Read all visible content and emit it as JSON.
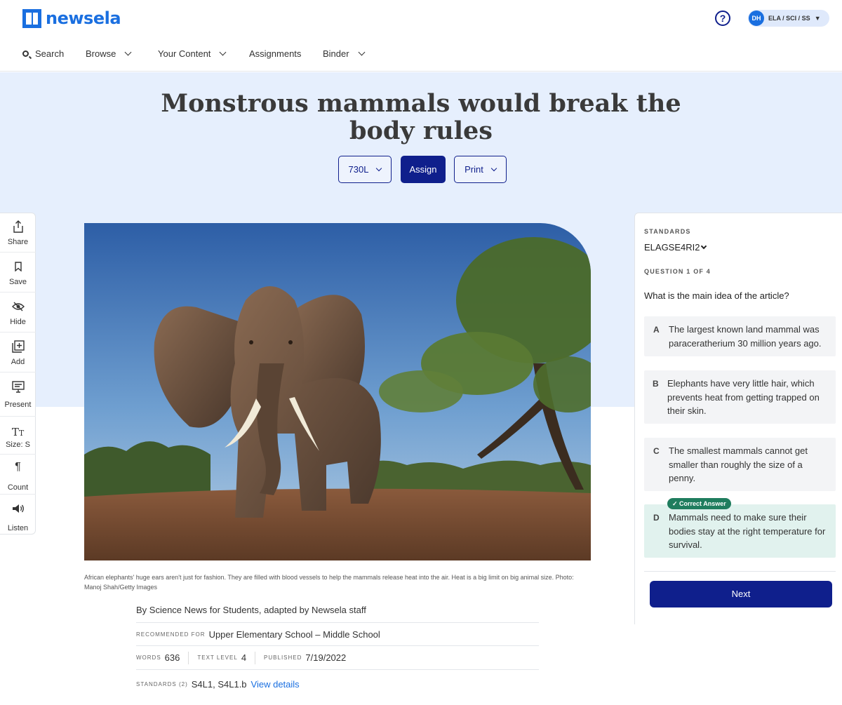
{
  "header": {
    "logo_text": "newsela",
    "help_icon": "?",
    "avatar_initials": "DH",
    "user_subjects": "ELA / SCI / SS"
  },
  "nav": {
    "search": "Search",
    "browse": "Browse",
    "your_content": "Your Content",
    "assignments": "Assignments",
    "binder": "Binder"
  },
  "article": {
    "title": "Monstrous mammals would break the body rules",
    "level_label": "730L",
    "assign_label": "Assign",
    "print_label": "Print",
    "caption": "African elephants' huge ears aren't just for fashion. They are filled with blood vessels to help the mammals release heat into the air. Heat is a big limit on big animal size. Photo: Manoj Shah/Getty Images",
    "byline": "By Science News for Students, adapted by Newsela staff",
    "recommended_label": "Recommended for",
    "recommended_value": "Upper Elementary School – Middle School",
    "words_label": "Words",
    "words_value": "636",
    "text_level_label": "Text Level",
    "text_level_value": "4",
    "published_label": "Published",
    "published_value": "7/19/2022",
    "standards_label": "Standards (2)",
    "standards_value": "S4L1, S4L1.b",
    "view_details": "View details"
  },
  "toolbar": {
    "items": [
      {
        "label": "Share",
        "icon": "share-icon"
      },
      {
        "label": "Save",
        "icon": "bookmark-icon"
      },
      {
        "label": "Hide",
        "icon": "eye-icon"
      },
      {
        "label": "Add",
        "icon": "add-icon"
      },
      {
        "label": "Present",
        "icon": "present-icon"
      },
      {
        "label": "Size: S",
        "icon": "text-size-icon"
      },
      {
        "label": "Count",
        "icon": "paragraph-icon"
      },
      {
        "label": "Listen",
        "icon": "speaker-icon"
      }
    ]
  },
  "quiz": {
    "standards_heading": "STANDARDS",
    "standard_selected": "ELAGSE4RI2",
    "question_counter": "QUESTION 1 OF 4",
    "question": "What is the main idea of the article?",
    "answers": [
      {
        "letter": "A",
        "text": "The largest known land mammal was paraceratherium 30 million years ago."
      },
      {
        "letter": "B",
        "text": "Elephants have very little hair, which prevents heat from getting trapped on their skin."
      },
      {
        "letter": "C",
        "text": "The smallest mammals cannot get smaller than roughly the size of a penny."
      },
      {
        "letter": "D",
        "text": "Mammals need to make sure their bodies stay at the right temperature for survival."
      }
    ],
    "correct_badge": "✓ Correct Answer",
    "next_label": "Next"
  },
  "colors": {
    "brand_blue": "#1a6fe0",
    "navy": "#0f1f8c",
    "hero_bg": "#e6effd",
    "correct_green": "#1f7d5e"
  }
}
